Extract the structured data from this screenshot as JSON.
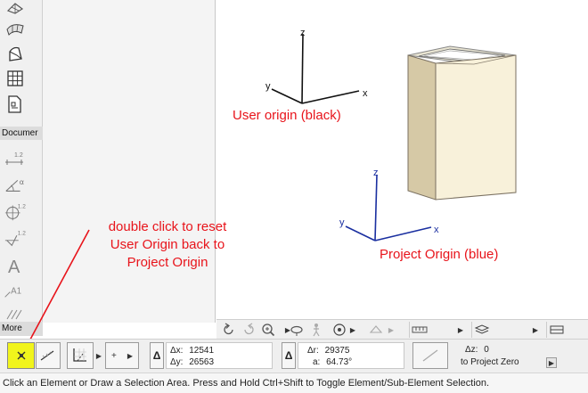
{
  "toolbox": {
    "section_document": "Documer",
    "more_label": "More",
    "tools": [
      {
        "name": "mesh-tool-icon"
      },
      {
        "name": "morph-tool-icon"
      },
      {
        "name": "curtain-wall-icon"
      },
      {
        "name": "stair-doc-icon"
      },
      {
        "name": "dimension-icon",
        "sup": "1.2"
      },
      {
        "name": "angle-dimension-icon",
        "sup": "α"
      },
      {
        "name": "radial-dimension-icon",
        "sup": "1.2"
      },
      {
        "name": "level-dimension-icon",
        "sup": "1.2"
      },
      {
        "name": "text-tool-icon",
        "glyph": "A"
      },
      {
        "name": "label-tool-icon",
        "glyph": "A1"
      },
      {
        "name": "fill-tool-icon"
      }
    ]
  },
  "canvas": {
    "user_origin_axes": {
      "x": "x",
      "y": "y",
      "z": "z"
    },
    "project_origin_axes": {
      "x": "x",
      "y": "y",
      "z": "z"
    },
    "user_origin_label": "User origin (black)",
    "project_origin_label": "Project Origin (blue)",
    "hint_lines": [
      "double click to reset",
      "User Origin back to",
      "Project Origin"
    ],
    "colors": {
      "annotation": "#e8141b",
      "user_axes": "#111111",
      "project_axes": "#1a2fa0",
      "highlight": "#f1f41c"
    }
  },
  "coordinates": {
    "dx_label": "Δx:",
    "dx_value": "12541",
    "dy_label": "Δy:",
    "dy_value": "26563",
    "dr_label": "Δr:",
    "dr_value": "29375",
    "a_label": "a:",
    "a_value": "64.73°",
    "dz_label": "Δz:",
    "dz_value": "0",
    "reference": "to Project Zero",
    "delta_symbol": "Δ"
  },
  "status": {
    "text": "Click an Element or Draw a Selection Area. Press and Hold Ctrl+Shift to Toggle Element/Sub-Element Selection."
  }
}
